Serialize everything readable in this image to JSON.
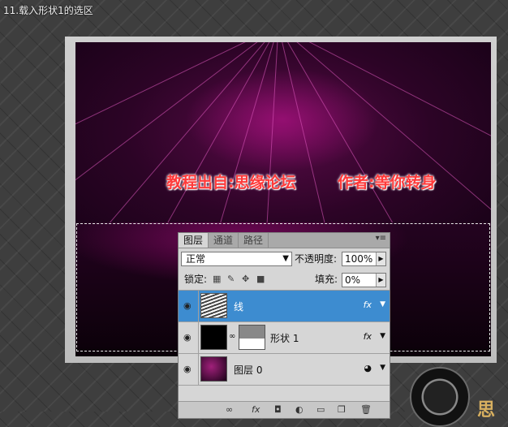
{
  "step_title": "11.载入形状1的选区",
  "canvas": {
    "caption_left": "教程出自:思缘论坛",
    "caption_right": "作者:等你转身",
    "colors": {
      "accent": "#c8168f",
      "caption": "#ff3a3a"
    }
  },
  "layers_panel": {
    "tabs": [
      {
        "label": "图层",
        "active": true
      },
      {
        "label": "通道",
        "active": false
      },
      {
        "label": "路径",
        "active": false
      }
    ],
    "menu_glyph": "▾≡",
    "blend_mode": "正常",
    "opacity_label": "不透明度:",
    "opacity_value": "100%",
    "lock_label": "锁定:",
    "fill_label": "填充:",
    "fill_value": "0%",
    "layers": [
      {
        "name": "线",
        "fx": "fx",
        "selected": true
      },
      {
        "name": "形状 1",
        "fx": "fx",
        "selected": false
      },
      {
        "name": "图层 0",
        "fx": "",
        "selected": false
      }
    ],
    "selected_color": "#3d8cd0"
  },
  "watermark_char": "思"
}
